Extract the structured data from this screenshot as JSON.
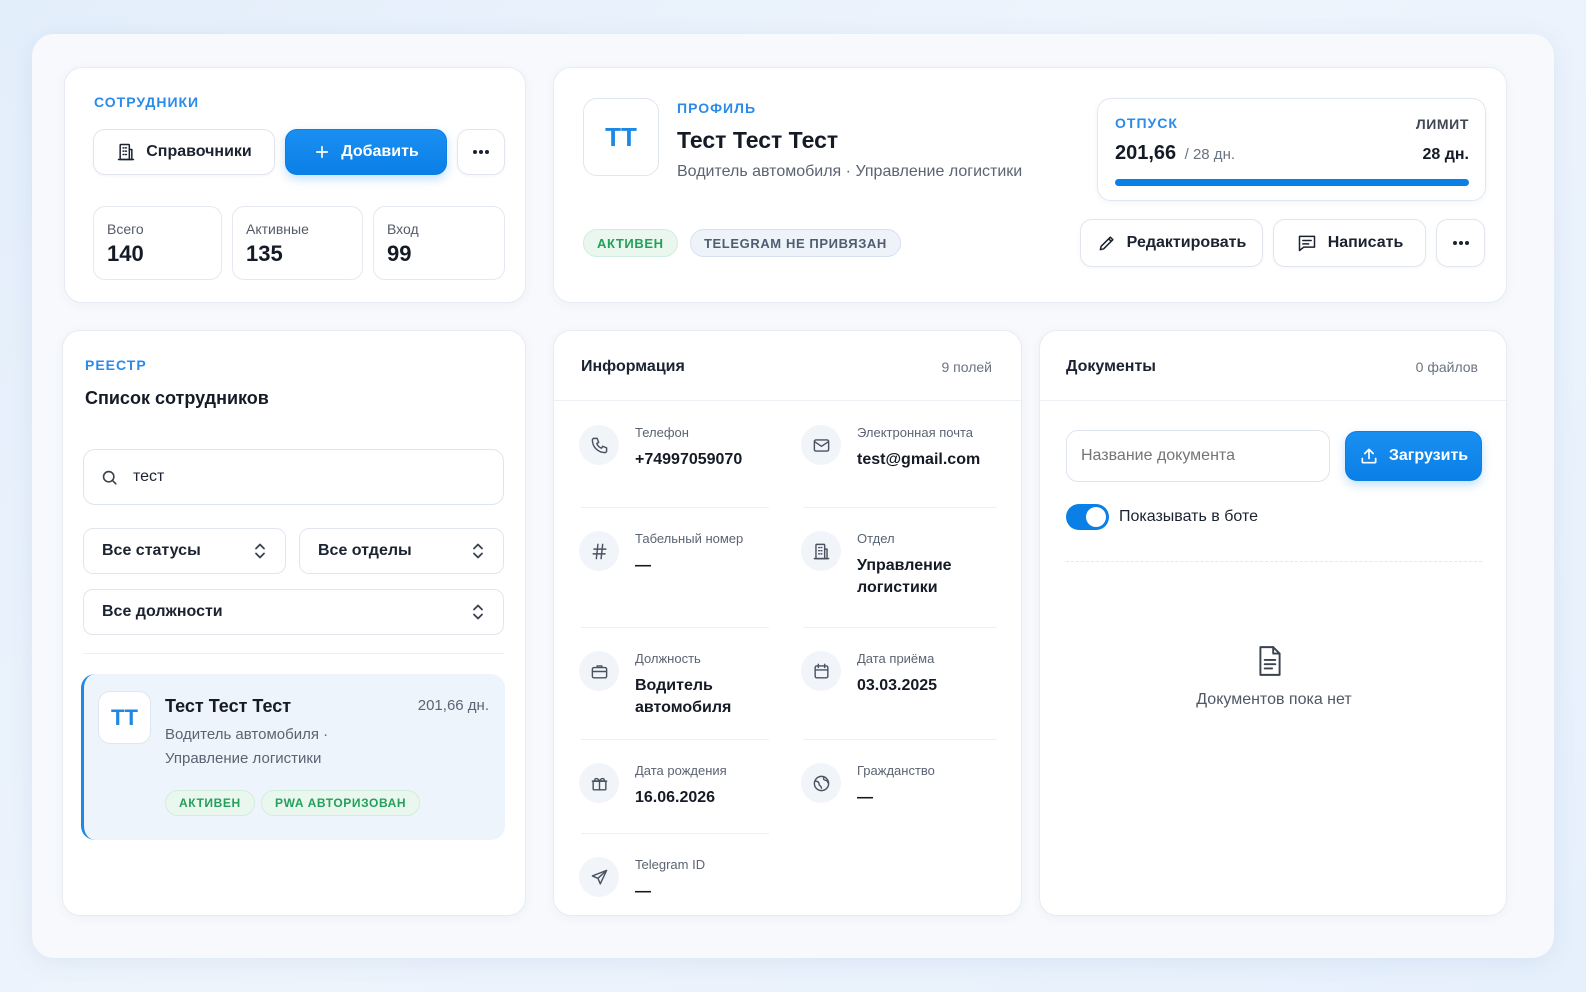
{
  "employees": {
    "eyebrow": "СОТРУДНИКИ",
    "directories_label": "Справочники",
    "add_label": "Добавить",
    "stats": [
      {
        "label": "Всего",
        "value": "140"
      },
      {
        "label": "Активные",
        "value": "135"
      },
      {
        "label": "Вход",
        "value": "99"
      }
    ]
  },
  "profile": {
    "eyebrow": "ПРОФИЛЬ",
    "initials": "ТТ",
    "name": "Тест Тест Тест",
    "subtitle": "Водитель автомобиля · Управление логистики",
    "badges": [
      "АКТИВЕН",
      "TELEGRAM НЕ ПРИВЯЗАН"
    ],
    "edit_label": "Редактировать",
    "message_label": "Написать",
    "vacation": {
      "eyebrow": "ОТПУСК",
      "limit_label": "ЛИМИТ",
      "used": "201,66",
      "total": "/ 28 дн.",
      "limit_value": "28 дн.",
      "progress": 1.0
    }
  },
  "registry": {
    "eyebrow": "РЕЕСТР",
    "title": "Список сотрудников",
    "search_value": "тест",
    "filters": {
      "status": "Все статусы",
      "department": "Все отделы",
      "position": "Все должности"
    },
    "items": [
      {
        "initials": "ТТ",
        "name": "Тест Тест Тест",
        "days": "201,66 дн.",
        "line1": "Водитель автомобиля ·",
        "line2": "Управление логистики",
        "badges": [
          "АКТИВЕН",
          "PWA АВТОРИЗОВАН"
        ]
      }
    ]
  },
  "info": {
    "title": "Информация",
    "count": "9 полей",
    "fields": {
      "phone": {
        "label": "Телефон",
        "value": "+74997059070",
        "icon": "phone-icon"
      },
      "email": {
        "label": "Электронная почта",
        "value": "test@gmail.com",
        "icon": "mail-icon"
      },
      "tab_number": {
        "label": "Табельный номер",
        "value": "—",
        "icon": "hash-icon"
      },
      "department": {
        "label": "Отдел",
        "value": "Управление логистики",
        "icon": "building-icon"
      },
      "position": {
        "label": "Должность",
        "value": "Водитель автомобиля",
        "icon": "briefcase-icon"
      },
      "hire_date": {
        "label": "Дата приёма",
        "value": "03.03.2025",
        "icon": "calendar-icon"
      },
      "birth_date": {
        "label": "Дата рождения",
        "value": "16.06.2026",
        "icon": "gift-icon"
      },
      "citizenship": {
        "label": "Гражданство",
        "value": "—",
        "icon": "globe-icon"
      },
      "telegram": {
        "label": "Telegram ID",
        "value": "—",
        "icon": "send-icon"
      }
    }
  },
  "documents": {
    "title": "Документы",
    "count": "0 файлов",
    "name_placeholder": "Название документа",
    "upload_label": "Загрузить",
    "toggle_label": "Показывать в боте",
    "toggle_on": true,
    "empty_text": "Документов пока нет"
  },
  "colors": {
    "accent": "#0a7fe6",
    "success": "#24a05a"
  }
}
